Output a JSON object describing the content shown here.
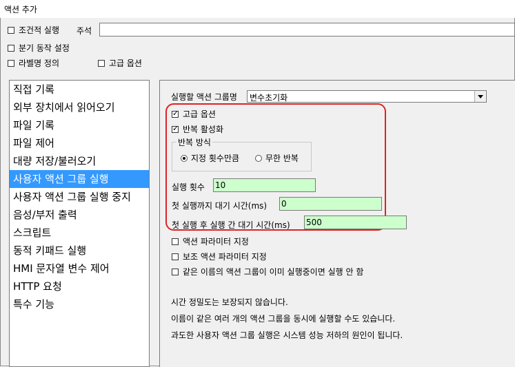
{
  "window": {
    "title": "액션 추가"
  },
  "top": {
    "conditional_exec": {
      "label": "조건적 실행",
      "checked": false
    },
    "comment_label": "주석",
    "comment_value": "",
    "branch_settings": {
      "label": "분기 동작 설정",
      "checked": false
    },
    "label_define": {
      "label": "라벨명 정의",
      "checked": false
    },
    "advanced_options": {
      "label": "고급 옵션",
      "checked": false
    }
  },
  "action_list": {
    "items": [
      "직접 기록",
      "외부 장치에서 읽어오기",
      "파일 기록",
      "파일 제어",
      "대량 저장/불러오기",
      "사용자 액션 그룹 실행",
      "사용자 액션 그룹 실행 중지",
      "음성/부저 출력",
      "스크립트",
      "동적 키패드 실행",
      "HMI 문자열 변수 제어",
      "HTTP 요청",
      "특수 기능"
    ],
    "selected_index": 5
  },
  "panel": {
    "group_label": "실행할 액션 그룹명",
    "group_value": "변수초기화",
    "advanced_options": {
      "label": "고급 옵션",
      "checked": true
    },
    "repeat_enable": {
      "label": "반복 활성화",
      "checked": true
    },
    "repeat_mode": {
      "title": "반복 방식",
      "option_count": "지정 횟수만큼",
      "option_infinite": "무한 반복",
      "selected": "option_count"
    },
    "exec_count": {
      "label": "실행 횟수",
      "value": "10"
    },
    "first_delay": {
      "label": "첫 실행까지 대기 시간(ms)",
      "value": "0"
    },
    "between_delay": {
      "label": "첫 실행 후 실행 간 대기 시간(ms)",
      "value": "500"
    },
    "action_param": {
      "label": "액션 파라미터 지정",
      "checked": false
    },
    "aux_action_param": {
      "label": "보조 액션 파라미터 지정",
      "checked": false
    },
    "no_run_if_running": {
      "label": "같은 이름의 액션 그룹이 이미 실행중이면 실행 안 함",
      "checked": false
    },
    "notes": [
      "시간 정밀도는 보장되지 않습니다.",
      "이름이 같은 여러 개의 액션 그룹을 동시에 실행할 수도 있습니다.",
      "과도한 사용자 액션 그룹 실행은 시스템 성능 저하의 원인이 됩니다."
    ]
  },
  "colors": {
    "highlight": "#e02020",
    "selected_item": "#3399ff",
    "input_green": "#ccffcc"
  }
}
